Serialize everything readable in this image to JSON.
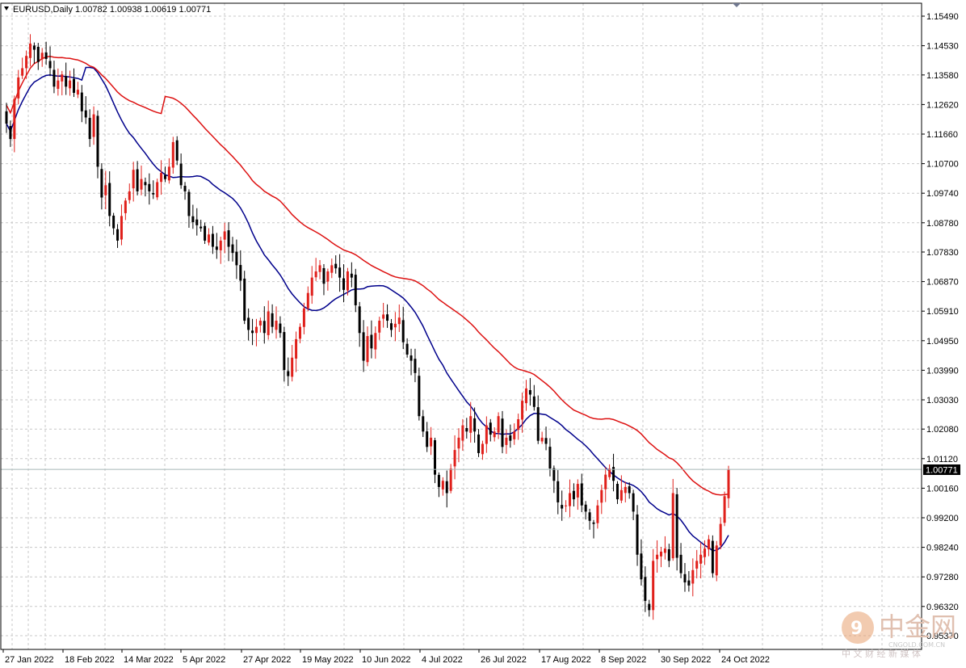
{
  "header": {
    "symbol": "EURUSD,Daily",
    "ohlc": "1.00782 1.00938 1.00619 1.00771"
  },
  "watermark": {
    "brand": "中金网",
    "site": "CNGOLD.COM.CN",
    "slogan": "中 文 财 经 新 媒 体"
  },
  "colors": {
    "bull": "#e0201b",
    "bear": "#000000",
    "ma_fast": "#00008b",
    "ma_slow": "#dd1111",
    "grid": "#c8c8c8",
    "current_price_line": "#a8b8b8"
  },
  "chart_data": {
    "type": "candlestick",
    "title": "",
    "symbol": "EURUSD",
    "timeframe": "Daily",
    "ylim": [
      0.9505,
      1.1585
    ],
    "grid": true,
    "y_ticks": [
      "1.15490",
      "1.14530",
      "1.13580",
      "1.12620",
      "1.11660",
      "1.10700",
      "1.09740",
      "1.08780",
      "1.07830",
      "1.06870",
      "1.05910",
      "1.04950",
      "1.03990",
      "1.03030",
      "1.02080",
      "1.01120",
      "1.00160",
      "0.99200",
      "0.98240",
      "0.97280",
      "0.96320",
      "0.95370"
    ],
    "x_ticks": [
      "27 Jan 2022",
      "18 Feb 2022",
      "14 Mar 2022",
      "5 Apr 2022",
      "27 Apr 2022",
      "19 May 2022",
      "10 Jun 2022",
      "4 Jul 2022",
      "26 Jul 2022",
      "17 Aug 2022",
      "8 Sep 2022",
      "30 Sep 2022",
      "24 Oct 2022"
    ],
    "current_price": "1.00771",
    "series_closes": [
      1.12,
      1.115,
      1.128,
      1.135,
      1.138,
      1.142,
      1.146,
      1.144,
      1.14,
      1.143,
      1.141,
      1.138,
      1.132,
      1.134,
      1.136,
      1.132,
      1.134,
      1.13,
      1.131,
      1.124,
      1.122,
      1.115,
      1.123,
      1.106,
      1.096,
      1.1,
      1.09,
      1.086,
      1.082,
      1.09,
      1.095,
      1.098,
      1.105,
      1.098,
      1.102,
      1.1,
      1.098,
      1.097,
      1.101,
      1.104,
      1.102,
      1.106,
      1.114,
      1.108,
      1.1,
      1.098,
      1.09,
      1.088,
      1.087,
      1.086,
      1.082,
      1.084,
      1.08,
      1.079,
      1.082,
      1.085,
      1.08,
      1.078,
      1.074,
      1.069,
      1.056,
      1.053,
      1.052,
      1.054,
      1.056,
      1.052,
      1.059,
      1.054,
      1.056,
      1.052,
      1.04,
      1.038,
      1.044,
      1.05,
      1.054,
      1.06,
      1.065,
      1.07,
      1.072,
      1.074,
      1.068,
      1.072,
      1.074,
      1.073,
      1.07,
      1.066,
      1.072,
      1.07,
      1.061,
      1.052,
      1.043,
      1.051,
      1.047,
      1.052,
      1.056,
      1.058,
      1.056,
      1.053,
      1.055,
      1.057,
      1.049,
      1.045,
      1.043,
      1.039,
      1.025,
      1.02,
      1.015,
      1.018,
      1.006,
      1.002,
      1.004,
      1.0,
      1.008,
      1.014,
      1.018,
      1.022,
      1.02,
      1.025,
      1.02,
      1.013,
      1.016,
      1.022,
      1.019,
      1.02,
      1.025,
      1.015,
      1.018,
      1.017,
      1.02,
      1.024,
      1.03,
      1.034,
      1.032,
      1.028,
      1.017,
      1.018,
      1.016,
      1.008,
      1.004,
      0.997,
      0.995,
      0.996,
      1.0,
      0.998,
      1.003,
      0.996,
      0.994,
      0.991,
      0.99,
      0.996,
      1.001,
      1.006,
      1.008,
      1.004,
      0.998,
      1.001,
      1.002,
      1.0,
      0.994,
      0.98,
      0.972,
      0.965,
      0.962,
      0.978,
      0.98,
      0.981,
      0.982,
      0.978,
      1.0,
      0.979,
      0.974,
      0.971,
      0.97,
      0.975,
      0.978,
      0.98,
      0.982,
      0.985,
      0.974,
      0.983,
      0.99,
      0.999,
      1.0077
    ],
    "ma_fast_end": 0.995,
    "ma_slow_end": 1.008
  }
}
